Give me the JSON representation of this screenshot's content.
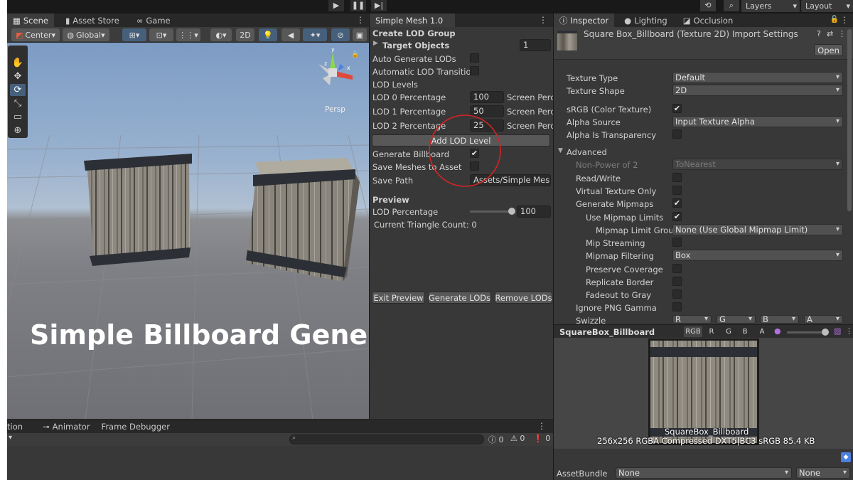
{
  "topbar": {
    "play_icon": "play-icon",
    "pause_icon": "pause-icon",
    "step_icon": "step-icon",
    "layers": "Layers",
    "layout": "Layout"
  },
  "scene": {
    "tabs": [
      "Scene",
      "Asset Store",
      "Game"
    ],
    "pivot": "Center",
    "space": "Global",
    "mode_2d": "2D",
    "persp": "Persp",
    "overlay_title": "Simple Billboard Generation"
  },
  "mesh": {
    "tab": "Simple Mesh 1.0",
    "section": "Create LOD Group",
    "target_objects": "Target Objects",
    "target_count": "1",
    "auto_generate": "Auto Generate LODs",
    "auto_transition": "Automatic LOD Transition",
    "lod_levels": "LOD Levels",
    "lods": [
      {
        "label": "LOD 0 Percentage",
        "value": "100",
        "unit": "Screen Perc"
      },
      {
        "label": "LOD 1 Percentage",
        "value": "50",
        "unit": "Screen Perc"
      },
      {
        "label": "LOD 2 Percentage",
        "value": "25",
        "unit": "Screen Perc"
      }
    ],
    "add_lod": "Add LOD Level",
    "gen_billboard": "Generate Billboard",
    "gen_billboard_checked": "✔",
    "save_meshes": "Save Meshes to Asset",
    "save_path_label": "Save Path",
    "save_path": "Assets/Simple Mesh",
    "preview": "Preview",
    "lod_pct_label": "LOD Percentage",
    "lod_pct_value": "100",
    "lod_pct_fraction": 1.0,
    "triangles": "Current Triangle Count: 0",
    "exit_preview": "Exit Preview",
    "generate_lods": "Generate LODs",
    "remove_lods": "Remove LODs"
  },
  "inspector": {
    "tabs": [
      "Inspector",
      "Lighting",
      "Occlusion"
    ],
    "title": "Square Box_Billboard (Texture 2D) Import Settings",
    "open": "Open",
    "texture_type_label": "Texture Type",
    "texture_type": "Default",
    "texture_shape_label": "Texture Shape",
    "texture_shape": "2D",
    "srgb_label": "sRGB (Color Texture)",
    "alpha_source_label": "Alpha Source",
    "alpha_source": "Input Texture Alpha",
    "alpha_transparency_label": "Alpha Is Transparency",
    "advanced": "Advanced",
    "npot_label": "Non-Power of 2",
    "npot": "ToNearest",
    "read_write": "Read/Write",
    "virtual_texture": "Virtual Texture Only",
    "gen_mipmaps": "Generate Mipmaps",
    "use_mip_limits": "Use Mipmap Limits",
    "mip_limit_group_label": "Mipmap Limit Group",
    "mip_limit_group": "None (Use Global Mipmap Limit)",
    "mip_streaming": "Mip Streaming",
    "mip_filtering_label": "Mipmap Filtering",
    "mip_filtering": "Box",
    "preserve_coverage": "Preserve Coverage",
    "replicate_border": "Replicate Border",
    "fadeout": "Fadeout to Gray",
    "ignore_png": "Ignore PNG Gamma",
    "swizzle_label": "Swizzle",
    "swizzle": [
      "R",
      "G",
      "B",
      "A"
    ],
    "check": "✔",
    "preview_name": "SquareBox_Billboard",
    "channels": [
      "RGB",
      "R",
      "G",
      "B",
      "A"
    ],
    "preview_caption": "SquareBox_Billboard",
    "preview_info": "256x256  RGBA Compressed DXT5|BC3 sRGB   85.4 KB",
    "assetbundle_label": "AssetBundle",
    "assetbundle": "None",
    "assetbundle_variant": "None"
  },
  "bottom": {
    "tabs": [
      "tion",
      "Animator",
      "Frame Debugger"
    ],
    "counts": [
      "0",
      "0",
      "0"
    ]
  },
  "colors": {
    "annotation_red": "#d42424",
    "accent_blue": "#46607c"
  }
}
